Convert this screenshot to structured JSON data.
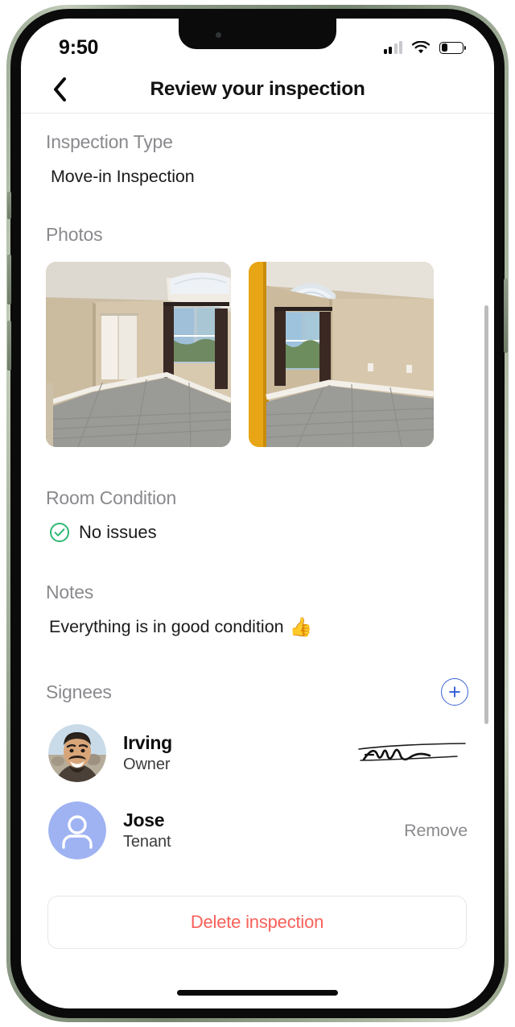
{
  "status_bar": {
    "time": "9:50",
    "signal_icon": "cellular-signal-icon",
    "signal_bars_total": 4,
    "signal_bars_filled": 2,
    "wifi_icon": "wifi-icon",
    "battery_icon": "battery-icon",
    "battery_percent": 26
  },
  "nav": {
    "back_icon": "chevron-left-icon",
    "title": "Review your inspection"
  },
  "sections": {
    "inspection_type": {
      "label": "Inspection Type",
      "value": "Move-in Inspection"
    },
    "photos": {
      "label": "Photos",
      "items": [
        {
          "name": "empty-bedroom-with-closet",
          "alt": "Empty bedroom with tan walls, gray wood floor, white closet doors and window with dark curtains"
        },
        {
          "name": "empty-bedroom-with-arched-window",
          "alt": "Empty bedroom with tan walls, gray wood floor, arched skylight window and dark curtains, yellow door frame at left"
        }
      ]
    },
    "room_condition": {
      "label": "Room Condition",
      "status_icon": "check-circle-icon",
      "status_color": "#2eb872",
      "value": "No issues"
    },
    "notes": {
      "label": "Notes",
      "value": "Everything is in good condition",
      "emoji": "👍"
    },
    "signees": {
      "label": "Signees",
      "add_icon": "plus-circle-icon",
      "add_color": "#3b63d6",
      "rows": [
        {
          "avatar_icon": "user-photo-avatar",
          "name": "Irving",
          "role": "Owner",
          "trailing_type": "signature",
          "trailing_label": "signature-image"
        },
        {
          "avatar_icon": "user-placeholder-avatar",
          "avatar_color": "#9fb3f2",
          "name": "Jose",
          "role": "Tenant",
          "trailing_type": "action",
          "trailing_label": "Remove"
        }
      ]
    }
  },
  "delete_button": {
    "label": "Delete inspection",
    "color": "#f8615a"
  },
  "home_indicator": "home-indicator-bar"
}
